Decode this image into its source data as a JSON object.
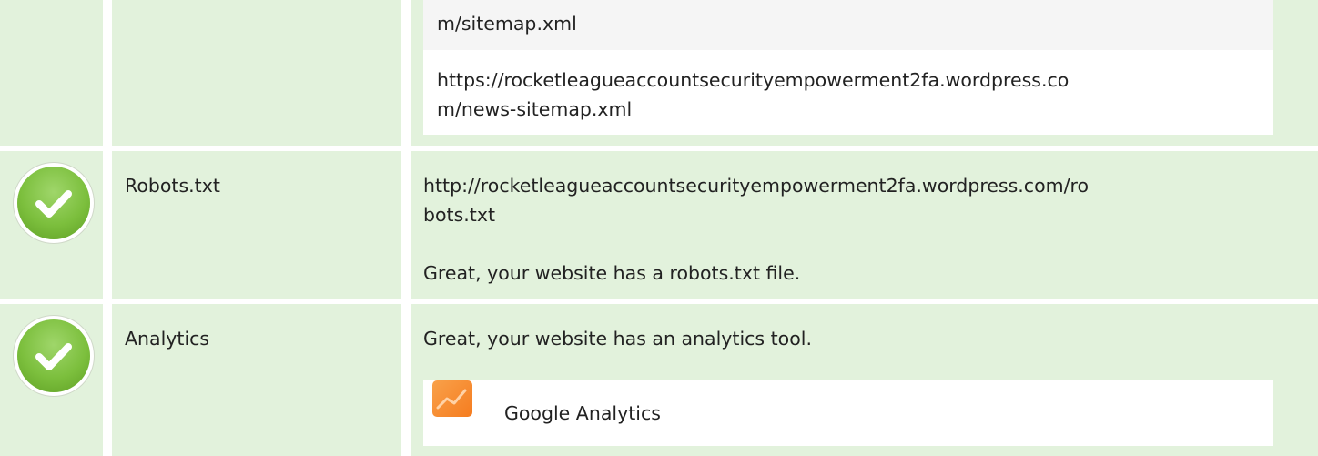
{
  "sitemap_row": {
    "lines": [
      "m/sitemap.xml",
      "https://rocketleagueaccountsecurityempowerment2fa.wordpress.co",
      "m/news-sitemap.xml"
    ]
  },
  "robots_row": {
    "label": "Robots.txt",
    "url_line1": "http://rocketleagueaccountsecurityempowerment2fa.wordpress.com/ro",
    "url_line2": "bots.txt",
    "message": "Great, your website has a robots.txt file.",
    "status_icon": "check-icon"
  },
  "analytics_row": {
    "label": "Analytics",
    "message": "Great, your website has an analytics tool.",
    "tool_name": "Google Analytics",
    "tool_icon": "google-analytics-icon",
    "status_icon": "check-icon"
  },
  "colors": {
    "row_background": "#e2f2dc",
    "check_green": "#7cbf3d",
    "analytics_orange": "#f57c1f"
  }
}
